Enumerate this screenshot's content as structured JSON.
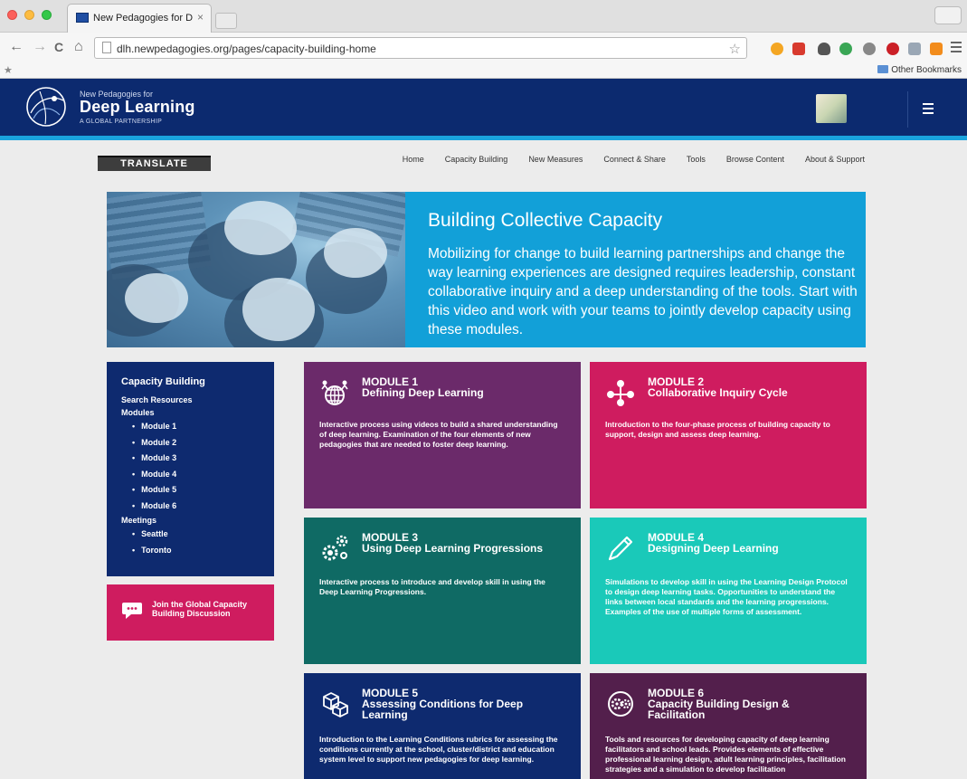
{
  "browser": {
    "tab_title": "New Pedagogies for Deep",
    "tab_close": "×",
    "url": "dlh.newpedagogies.org/pages/capacity-building-home",
    "bookmarks_other": "Other Bookmarks",
    "nav_back": "←",
    "nav_forward": "→",
    "nav_reload": "C",
    "nav_home": "⌂",
    "bookmark_star": "☆",
    "bookmarks_star": "★"
  },
  "header": {
    "logo_kicker": "New Pedagogies for",
    "logo_title": "Deep Learning",
    "logo_sub": "A GLOBAL PARTNERSHIP"
  },
  "translate_label": "TRANSLATE",
  "topnav": [
    "Home",
    "Capacity Building",
    "New Measures",
    "Connect & Share",
    "Tools",
    "Browse Content",
    "About & Support"
  ],
  "hero": {
    "title": "Building Collective Capacity",
    "body": "Mobilizing for change to build learning partnerships and change the way learning experiences are designed requires leadership, constant collaborative inquiry and a deep understanding of the tools. Start with this video and work with your teams to jointly develop capacity using these modules."
  },
  "sidebar": {
    "title": "Capacity Building",
    "search": "Search Resources",
    "modules_label": "Modules",
    "modules": [
      "Module 1",
      "Module 2",
      "Module 3",
      "Module 4",
      "Module 5",
      "Module 6"
    ],
    "meetings_label": "Meetings",
    "meetings": [
      "Seattle",
      "Toronto"
    ]
  },
  "discussion": {
    "label": "Join the Global Capacity Building Discussion"
  },
  "modules": [
    {
      "num": "MODULE 1",
      "title": "Defining Deep Learning",
      "desc": "Interactive process using videos to build a shared understanding of deep learning. Examination of the four elements of new pedagogies that are needed to foster deep learning.",
      "icon": "globe-people-icon",
      "color": "#6b2a6a"
    },
    {
      "num": "MODULE 2",
      "title": "Collaborative Inquiry Cycle",
      "desc": "Introduction to the four-phase process of building capacity to support, design and assess deep learning.",
      "icon": "network-icon",
      "color": "#cf1c5f"
    },
    {
      "num": "MODULE 3",
      "title": "Using Deep Learning Progressions",
      "desc": "Interactive process to introduce and develop skill in using the Deep Learning Progressions.",
      "icon": "gears-icon",
      "color": "#0f6a64"
    },
    {
      "num": "MODULE 4",
      "title": "Designing Deep Learning",
      "desc": "Simulations to develop skill in using the Learning Design Protocol to design deep learning tasks. Opportunities to understand the links between local standards and the learning progressions. Examples of the use of multiple forms of assessment.",
      "icon": "pencil-icon",
      "color": "#1ac9b9"
    },
    {
      "num": "MODULE 5",
      "title": "Assessing Conditions for Deep Learning",
      "desc": "Introduction to the Learning Conditions rubrics for assessing the conditions currently at the school, cluster/district and education system level to support new pedagogies for deep learning.",
      "icon": "blocks-icon",
      "color": "#0e2a6f"
    },
    {
      "num": "MODULE 6",
      "title": "Capacity Building Design & Facilitation",
      "desc": "Tools and resources for developing capacity of deep learning facilitators and school leads. Provides elements of effective professional learning design, adult learning principles, facilitation strategies and a simulation to develop facilitation",
      "icon": "gear-cycle-icon",
      "color": "#531f4c"
    }
  ]
}
